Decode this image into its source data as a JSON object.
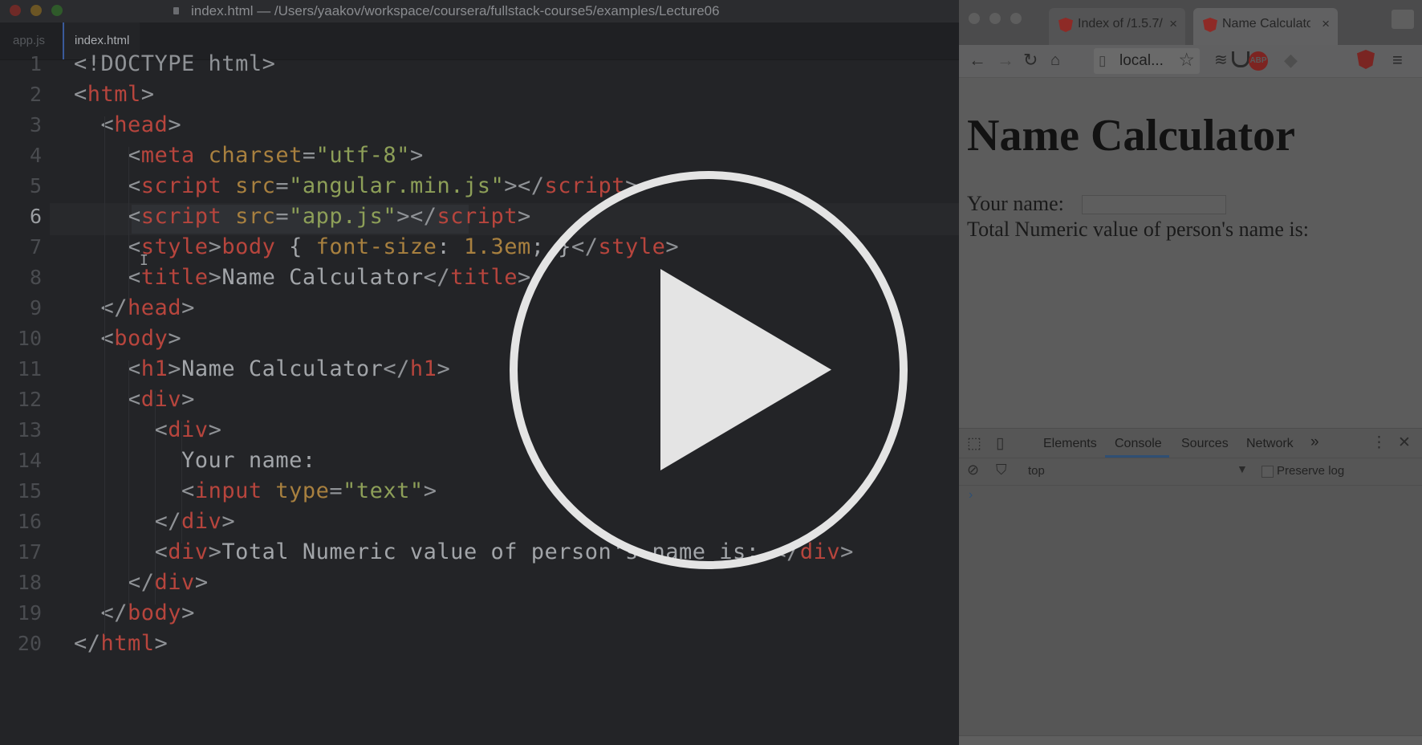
{
  "editor": {
    "window_title": "index.html — /Users/yaakov/workspace/coursera/fullstack-course5/examples/Lecture06",
    "tabs": [
      {
        "label": "app.js",
        "active": false
      },
      {
        "label": "index.html",
        "active": true
      }
    ],
    "current_line": 6,
    "line_numbers": [
      "1",
      "2",
      "3",
      "4",
      "5",
      "6",
      "7",
      "8",
      "9",
      "10",
      "11",
      "12",
      "13",
      "14",
      "15",
      "16",
      "17",
      "18",
      "19",
      "20"
    ],
    "code_lines": [
      [
        [
          "pun",
          "<!DOCTYPE html>"
        ]
      ],
      [
        [
          "pun",
          "<"
        ],
        [
          "tag",
          "html"
        ],
        [
          "pun",
          ">"
        ]
      ],
      [
        [
          "pun",
          "  <"
        ],
        [
          "tag",
          "head"
        ],
        [
          "pun",
          ">"
        ]
      ],
      [
        [
          "pun",
          "    <"
        ],
        [
          "tag",
          "meta"
        ],
        [
          "txt",
          " "
        ],
        [
          "att",
          "charset"
        ],
        [
          "pun",
          "="
        ],
        [
          "str",
          "\"utf-8\""
        ],
        [
          "pun",
          ">"
        ]
      ],
      [
        [
          "pun",
          "    <"
        ],
        [
          "tag",
          "script"
        ],
        [
          "txt",
          " "
        ],
        [
          "att",
          "src"
        ],
        [
          "pun",
          "="
        ],
        [
          "str",
          "\"angular.min.js\""
        ],
        [
          "pun",
          "></"
        ],
        [
          "tag",
          "script"
        ],
        [
          "pun",
          ">"
        ]
      ],
      [
        [
          "pun",
          "    <"
        ],
        [
          "tag",
          "script"
        ],
        [
          "txt",
          " "
        ],
        [
          "att",
          "src"
        ],
        [
          "pun",
          "="
        ],
        [
          "str",
          "\"app.js\""
        ],
        [
          "pun",
          "></"
        ],
        [
          "tag",
          "script"
        ],
        [
          "pun",
          ">"
        ]
      ],
      [
        [
          "pun",
          "    <"
        ],
        [
          "tag",
          "style"
        ],
        [
          "pun",
          ">"
        ],
        [
          "tag",
          "body"
        ],
        [
          "txt",
          " { "
        ],
        [
          "att",
          "font-size"
        ],
        [
          "txt",
          ": "
        ],
        [
          "att",
          "1.3em"
        ],
        [
          "txt",
          "; }"
        ],
        [
          "pun",
          "</"
        ],
        [
          "tag",
          "style"
        ],
        [
          "pun",
          ">"
        ]
      ],
      [
        [
          "pun",
          "    <"
        ],
        [
          "tag",
          "title"
        ],
        [
          "pun",
          ">"
        ],
        [
          "txt",
          "Name Calculator"
        ],
        [
          "pun",
          "</"
        ],
        [
          "tag",
          "title"
        ],
        [
          "pun",
          ">"
        ]
      ],
      [
        [
          "pun",
          "  </"
        ],
        [
          "tag",
          "head"
        ],
        [
          "pun",
          ">"
        ]
      ],
      [
        [
          "pun",
          "  <"
        ],
        [
          "tag",
          "body"
        ],
        [
          "pun",
          ">"
        ]
      ],
      [
        [
          "pun",
          "    <"
        ],
        [
          "tag",
          "h1"
        ],
        [
          "pun",
          ">"
        ],
        [
          "txt",
          "Name Calculator"
        ],
        [
          "pun",
          "</"
        ],
        [
          "tag",
          "h1"
        ],
        [
          "pun",
          ">"
        ]
      ],
      [
        [
          "pun",
          "    <"
        ],
        [
          "tag",
          "div"
        ],
        [
          "pun",
          ">"
        ]
      ],
      [
        [
          "pun",
          "      <"
        ],
        [
          "tag",
          "div"
        ],
        [
          "pun",
          ">"
        ]
      ],
      [
        [
          "txt",
          "        Your name:"
        ]
      ],
      [
        [
          "pun",
          "        <"
        ],
        [
          "tag",
          "input"
        ],
        [
          "txt",
          " "
        ],
        [
          "att",
          "type"
        ],
        [
          "pun",
          "="
        ],
        [
          "str",
          "\"text\""
        ],
        [
          "pun",
          ">"
        ]
      ],
      [
        [
          "pun",
          "      </"
        ],
        [
          "tag",
          "div"
        ],
        [
          "pun",
          ">"
        ]
      ],
      [
        [
          "pun",
          "      <"
        ],
        [
          "tag",
          "div"
        ],
        [
          "pun",
          ">"
        ],
        [
          "txt",
          "Total Numeric value of person's name is: "
        ],
        [
          "pun",
          "</"
        ],
        [
          "tag",
          "div"
        ],
        [
          "pun",
          ">"
        ]
      ],
      [
        [
          "pun",
          "    </"
        ],
        [
          "tag",
          "div"
        ],
        [
          "pun",
          ">"
        ]
      ],
      [
        [
          "pun",
          "  </"
        ],
        [
          "tag",
          "body"
        ],
        [
          "pun",
          ">"
        ]
      ],
      [
        [
          "pun",
          "</"
        ],
        [
          "tag",
          "html"
        ],
        [
          "pun",
          ">"
        ]
      ]
    ]
  },
  "browser": {
    "tabs": [
      {
        "label": "Index of /1.5.7/",
        "close": "×"
      },
      {
        "label": "Name Calculator",
        "close": "×"
      }
    ],
    "url": "local...",
    "page": {
      "heading": "Name Calculator",
      "name_label": "Your name:",
      "total_label": "Total Numeric value of person's name is:"
    },
    "devtools": {
      "tabs": [
        "Elements",
        "Console",
        "Sources",
        "Network"
      ],
      "more": "»",
      "active_tab": "Console",
      "context": "top",
      "preserve_log": "Preserve log",
      "prompt": "›"
    },
    "extensions": {
      "abp": "ABP"
    }
  },
  "overlay": {
    "type": "play-button"
  },
  "colors": {
    "editor_bg": "#232427",
    "tag": "#b7453d",
    "attr": "#a8803f",
    "string": "#8d9f58",
    "text": "#a2a5a9",
    "devtools_accent": "#2f4f73"
  }
}
